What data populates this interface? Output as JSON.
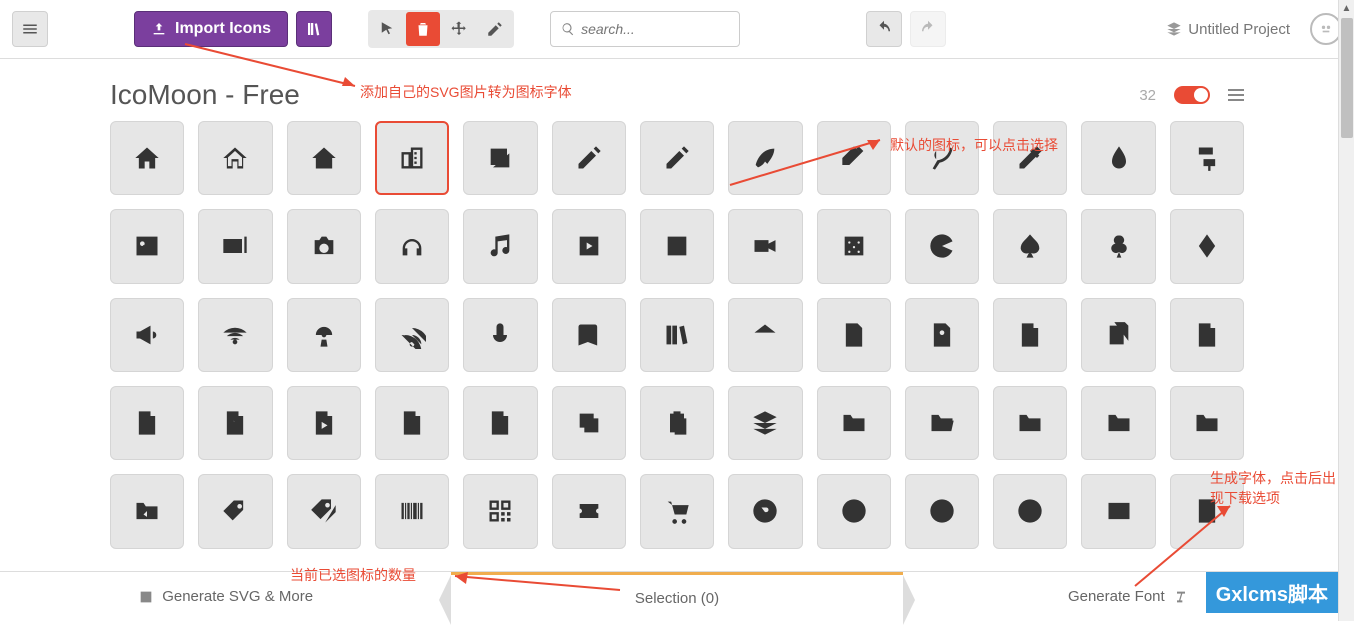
{
  "topbar": {
    "import_label": "Import Icons",
    "search_placeholder": "search...",
    "project_name": "Untitled Project"
  },
  "library": {
    "title": "IcoMoon - Free",
    "count": "32"
  },
  "icons": {
    "row1": [
      "home",
      "home2",
      "home3",
      "office",
      "newspaper",
      "pencil",
      "pencil2",
      "quill",
      "pen",
      "blog",
      "eyedropper",
      "droplet",
      "paint-format"
    ],
    "row2": [
      "image",
      "images",
      "camera",
      "headphones",
      "music",
      "play",
      "film",
      "video-camera",
      "dice",
      "pacman",
      "spades",
      "clubs",
      "diamonds"
    ],
    "row3": [
      "bullhorn",
      "connection",
      "podcast",
      "feed",
      "mic",
      "book",
      "books",
      "library",
      "file-text",
      "profile",
      "file-empty",
      "files-empty",
      "file-text2"
    ],
    "row4": [
      "file-picture",
      "file-music",
      "file-play",
      "file-video",
      "file-zip",
      "copy",
      "paste",
      "stack",
      "folder",
      "folder-open",
      "folder-plus",
      "folder-minus",
      "folder-download"
    ],
    "row5": [
      "folder-upload",
      "price-tag",
      "price-tags",
      "barcode",
      "qrcode",
      "ticket",
      "cart",
      "coin-dollar",
      "coin-euro",
      "coin-pound",
      "coin-yen",
      "credit-card",
      "calculator"
    ]
  },
  "selected_icon": "office",
  "bottombar": {
    "svg_label": "Generate SVG & More",
    "selection_label": "Selection (0)",
    "font_label": "Generate Font"
  },
  "annotations": {
    "a1": "添加自己的SVG图片转为图标字体",
    "a2": "默认的图标，可以点击选择",
    "a3": "当前已选图标的数量",
    "a4": "生成字体，点击后出现下载选项"
  },
  "watermark": "Gxlcms脚本"
}
